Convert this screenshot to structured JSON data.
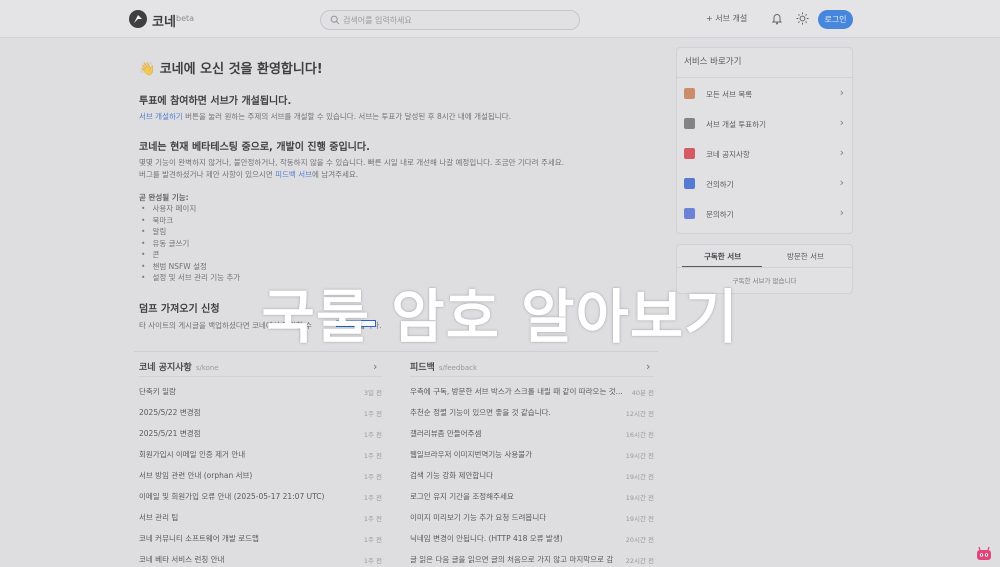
{
  "header": {
    "logo_text": "코네",
    "beta": "beta",
    "search_placeholder": "검색어를 입력하세요",
    "open_label": "+ 서브 개설",
    "login_label": "로그인"
  },
  "main": {
    "welcome": "👋 코네에 오신 것을 환영합니다!",
    "vote_title": "투표에 참여하면 서브가 개설됩니다.",
    "vote_link": "서브 개설하기",
    "vote_text": " 버튼을 눌러 원하는 주제의 서브를 개설할 수 있습니다. 서브는 투표가 달성된 후 8시간 내에 개설됩니다.",
    "beta_title": "코네는 현재 베타테스팅 중으로, 개발이 진행 중입니다.",
    "beta_text1": "몇몇 기능이 완벽하지 않거나, 불안정하거나, 작동하지 않을 수 있습니다. 빠른 시일 내로 개선해 나갈 예정입니다. 조금만 기다려 주세요.",
    "beta_text2_a": "버그를 발견하셨거나 제안 사항이 있으시면 ",
    "beta_text2_link": "피드백 서브",
    "beta_text2_b": "에 남겨주세요.",
    "features_title": "곧 완성될 기능:",
    "features": [
      "사용자 페이지",
      "북마크",
      "알림",
      "유동 글쓰기",
      "콘",
      "챈범 NSFW 설정",
      "설정 및 서브 관리 기능 추가"
    ],
    "import_title": "덤프 가져오기 신청",
    "import_text": "타 사이트의 게시글을 백업하셨다면 코네에서 복원할 수 ",
    "import_text_tail": "습니다."
  },
  "panels": {
    "notice": {
      "title": "코네 공지사항",
      "sub": "s/kone",
      "rows": [
        {
          "title": "단축키 일람",
          "time": "3일 전"
        },
        {
          "title": "2025/5/22 변경점",
          "time": "1주 전"
        },
        {
          "title": "2025/5/21 변경점",
          "time": "1주 전"
        },
        {
          "title": "회원가입시 이메일 인증 제거 안내",
          "time": "1주 전"
        },
        {
          "title": "서브 방임 관련 안내 (orphan 서브)",
          "time": "1주 전"
        },
        {
          "title": "이메일 및 회원가입 오류 안내 (2025-05-17 21:07 UTC)",
          "time": "1주 전"
        },
        {
          "title": "서브 관리 팁",
          "time": "1주 전"
        },
        {
          "title": "코네 커뮤니티 소프트웨어 개발 로드맵",
          "time": "1주 전"
        },
        {
          "title": "코네 베타 서비스 런칭 안내",
          "time": "1주 전"
        }
      ]
    },
    "feedback": {
      "title": "피드백",
      "sub": "s/feedback",
      "rows": [
        {
          "title": "우측에 구독, 방문한 서브 박스가 스크롤 내릴 때 같이 따라오는 것...",
          "time": "40분 전"
        },
        {
          "title": "추천순 정렬 기능이 있으면 좋을 것 같습니다.",
          "time": "12시간 전"
        },
        {
          "title": "갤러리뷰좀 만들어주셈",
          "time": "16시간 전"
        },
        {
          "title": "웹일브라우저 이미지번역기능 사용불가",
          "time": "19시간 전"
        },
        {
          "title": "검색 기능 강화 제안합니다",
          "time": "19시간 전"
        },
        {
          "title": "로그인 유지 기간을 조정해주세요",
          "time": "19시간 전"
        },
        {
          "title": "이미지 미리보기 기능 추가 요청 드려봅니다",
          "time": "19시간 전"
        },
        {
          "title": "닉네임 변경이 안됩니다. (HTTP 418 오류 발생)",
          "time": "20시간 전"
        },
        {
          "title": "글 읽은 다음 글을 읽으면 글의 처음으로 가지 않고 마지막으로 감",
          "time": "22시간 전"
        }
      ]
    }
  },
  "sidebar": {
    "title": "서비스 바로가기",
    "items": [
      {
        "label": "모든 서브 목록",
        "icon": "book-icon",
        "color": "#c9784a"
      },
      {
        "label": "서브 개설 투표하기",
        "icon": "ballot-icon",
        "color": "#6b6b6b"
      },
      {
        "label": "코네 공지사항",
        "icon": "megaphone-icon",
        "color": "#d8343f"
      },
      {
        "label": "건의하기",
        "icon": "thumbs-up-icon",
        "color": "#2f5fd0"
      },
      {
        "label": "문의하기",
        "icon": "chat-icon",
        "color": "#4e6ad8"
      }
    ],
    "tabs": [
      "구독한 서브",
      "방문한 서브"
    ],
    "empty": "구독한 서브가 없습니다"
  },
  "overlay": {
    "text": "국룰 암호 알아보기"
  }
}
